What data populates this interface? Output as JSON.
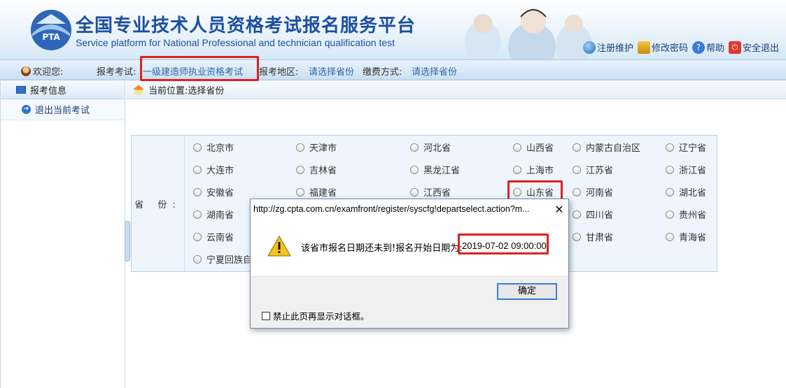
{
  "header": {
    "title_cn": "全国专业技术人员资格考试报名服务平台",
    "title_en": "Service platform for National Professional and technician qualification test",
    "logo_text": "PTA",
    "links": {
      "register_maint": "注册维护",
      "change_password": "修改密码",
      "help": "帮助",
      "logout": "安全退出"
    }
  },
  "infobar": {
    "welcome": "欢迎您:",
    "exam_label": "报考考试:",
    "exam_value": "一级建造师执业资格考试",
    "region_label": "报考地区:",
    "region_value": "请选择省份",
    "pay_label": "缴费方式:",
    "pay_value": "请选择省份"
  },
  "sidebar": {
    "header": "报考信息",
    "item": "退出当前考试"
  },
  "breadcrumb": {
    "text": "当前位置:选择省份"
  },
  "provinces": {
    "label": "省 份:",
    "items": [
      "北京市",
      "天津市",
      "河北省",
      "山西省",
      "内蒙古自治区",
      "辽宁省",
      "大连市",
      "吉林省",
      "黑龙江省",
      "上海市",
      "江苏省",
      "浙江省",
      "安徽省",
      "福建省",
      "江西省",
      "山东省",
      "河南省",
      "湖北省",
      "湖南省",
      "四川省",
      "贵州省",
      "云南省",
      "甘肃省",
      "青海省",
      "宁夏回族自治区"
    ]
  },
  "dialog": {
    "title": "http://zg.cpta.com.cn/examfront/register/syscfg!departselect.action?m...",
    "close": "✕",
    "message": "该省市报名日期还未到!报名开始日期为:",
    "date": "2019-07-02 09:00:00",
    "ok": "确定",
    "suppress": "禁止此页再显示对话框。"
  },
  "colors": {
    "brand": "#1d4fa0",
    "link": "#3366aa",
    "highlight": "#e02020"
  }
}
